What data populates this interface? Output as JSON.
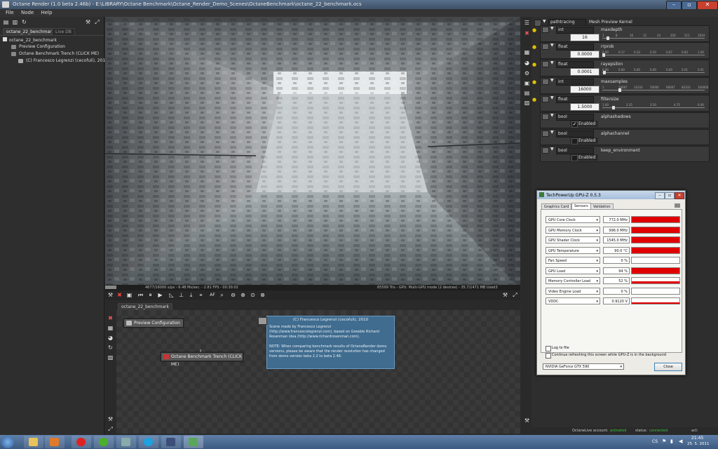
{
  "window": {
    "title": "Octane Render (1.0 beta 2.46b) - E:\\LIBRARY\\Octane Benchmark\\Octane_Render_Demo_Scenes\\OctaneBenchmark\\octane_22_benchmark.ocs",
    "buttons": {
      "minimize": "–",
      "maximize": "▫",
      "close": "✕"
    }
  },
  "menu": [
    "File",
    "Node",
    "Help"
  ],
  "left_panel": {
    "tabs": [
      "octane_22_benchmark",
      "Live DB"
    ],
    "tree": [
      {
        "label": "octane_22_benchmark"
      },
      {
        "label": "Preview Configuration"
      },
      {
        "label": "Octane Benchmark Trench (CLICK ME)"
      },
      {
        "label": "(C) Francesco Legrenzi (cecofuli), 2010"
      }
    ]
  },
  "viewport": {
    "status_left": "4677/16000 s/px - 6.48 Ms/sec. - 2.81 FPS - 00:30:02",
    "status_right": "65599 Tris - GPU: Multi-GPU mode (2 devices) - 35.7/1471 MB Used3",
    "toolbar": {
      "af": "AF",
      "zoom_out": "⊖",
      "zoom_in": "⊕",
      "reset": "⊙"
    }
  },
  "node_graph": {
    "tab": "octane_22_benchmark",
    "nodes": [
      {
        "label": "Preview Configuration"
      },
      {
        "label": "Octane Benchmark Trench (CLICK ME)"
      }
    ],
    "note": {
      "title": "(C) Francesco Legrenzi (cecofuli), 2010",
      "lines": [
        "Scene made by Francesco Legrenzi",
        "(http://www.francescolegrenzi.com), based on Greeble Richard",
        "Rosenman idea (http://www.richardrosenman.com).",
        "",
        "NOTE: When comparing benchmark results of OctaneRender demo",
        "versions, please be aware that the render resolution has changed",
        "from demo version beta 2.2 to beta 2.46."
      ]
    }
  },
  "kernel": {
    "type": "pathtracing",
    "name": "Mesh Preview Kernel"
  },
  "params": [
    {
      "type": "int",
      "name": "maxdepth",
      "value": "16",
      "ticks": [
        "1",
        "8",
        "16",
        "12",
        "24",
        "256",
        "512",
        "1024"
      ],
      "level": 0.04
    },
    {
      "type": "float",
      "name": "rrprob",
      "value": "0.0000",
      "ticks": [
        "0.00",
        "0.17",
        "0.33",
        "0.50",
        "0.67",
        "0.83",
        "1.00"
      ],
      "level": 0.0
    },
    {
      "type": "float",
      "name": "rayepsilon",
      "value": "0.0001",
      "ticks": [
        "0.00",
        "0.00",
        "0.00",
        "0.00",
        "0.00",
        "0.01",
        "0.01"
      ],
      "level": 0.01
    },
    {
      "type": "int",
      "name": "maxsamples",
      "value": "16000",
      "ticks": [
        "1",
        "16667",
        "33333",
        "50000",
        "66667",
        "83333",
        "100000"
      ],
      "level": 0.16
    },
    {
      "type": "float",
      "name": "filtersize",
      "value": "1.5000",
      "ticks": [
        "1.00",
        "2.25",
        "3.50",
        "4.75",
        "6.00"
      ],
      "level": 0.1
    }
  ],
  "bools": [
    {
      "type": "bool",
      "name": "alphashadows",
      "label": "Enabled",
      "checked": true
    },
    {
      "type": "bool",
      "name": "alphachannel",
      "label": "Enabled",
      "checked": false
    },
    {
      "type": "bool",
      "name": "keep_environment",
      "label": "Enabled",
      "checked": false
    }
  ],
  "gpuz": {
    "title": "TechPowerUp GPU-Z 0.5.3",
    "tabs": [
      "Graphics Card",
      "Sensors",
      "Validation"
    ],
    "sensors": [
      {
        "label": "GPU Core Clock",
        "value": "772.0 MHz",
        "fill": 1.0
      },
      {
        "label": "GPU Memory Clock",
        "value": "996.0 MHz",
        "fill": 1.0
      },
      {
        "label": "GPU Shader Clock",
        "value": "1545.0 MHz",
        "fill": 1.0
      },
      {
        "label": "GPU Temperature",
        "value": "90.0 °C",
        "fill": 1.0
      },
      {
        "label": "Fan Speed",
        "value": "0 %",
        "fill": 0.0
      },
      {
        "label": "GPU Load",
        "value": "94 %",
        "fill": 0.94
      },
      {
        "label": "Memory Controller Load",
        "value": "52 %",
        "fill": 0.4
      },
      {
        "label": "Video Engine Load",
        "value": "0 %",
        "fill": 0.0
      },
      {
        "label": "VDDC",
        "value": "0.9120 V",
        "fill": 0.3
      }
    ],
    "log_to_file": "Log to file",
    "continue_refresh": "Continue refreshing this screen while GPU-Z is in the background",
    "device": "NVIDIA GeForce GTX 590",
    "close": "Close"
  },
  "status": {
    "account_label": "OctaneLive account:",
    "account_value": "activated",
    "status_label": "status:",
    "status_value": "connected",
    "act_label": "act:"
  },
  "taskbar": {
    "lang": "CS",
    "time": "21:45",
    "date": "25. 5. 2011"
  },
  "colors": {
    "accent_green": "#3cc23c",
    "gpuz_bar": "#e00000",
    "note_bg": "#3f6c8f"
  }
}
